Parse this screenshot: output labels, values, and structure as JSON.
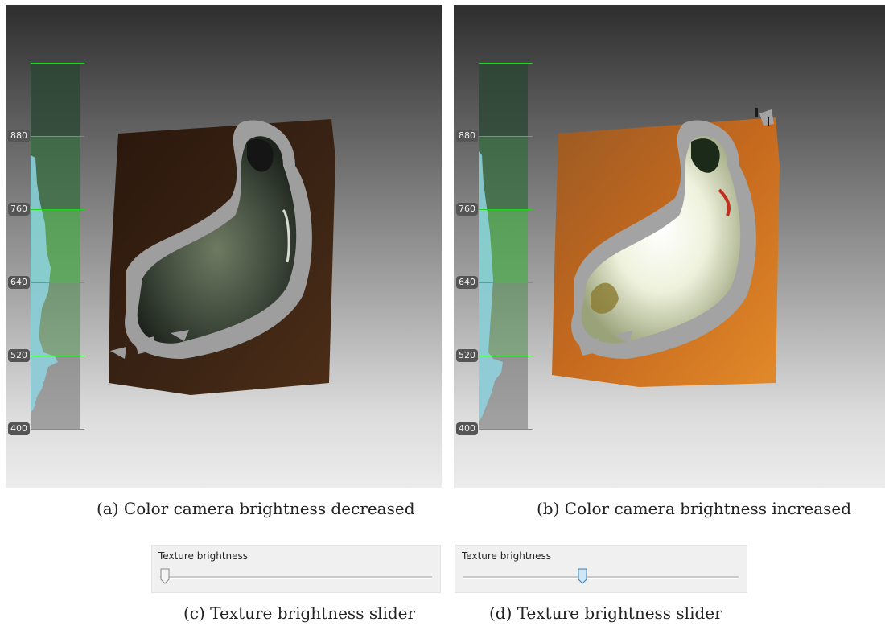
{
  "panels": {
    "a": {
      "gauge_ticks": [
        "880",
        "760",
        "640",
        "520",
        "400"
      ],
      "caption": "(a) Color camera brightness decreased"
    },
    "b": {
      "gauge_ticks": [
        "880",
        "760",
        "640",
        "520",
        "400"
      ],
      "caption": "(b) Color camera brightness increased"
    }
  },
  "sliders": {
    "c": {
      "title": "Texture brightness",
      "value_fraction": 0.0,
      "caption": "(c) Texture brightness slider"
    },
    "d": {
      "title": "Texture brightness",
      "value_fraction": 0.43,
      "caption": "(d) Texture brightness slider"
    }
  },
  "colors": {
    "gauge_line": "#22d422",
    "histogram": "#8fd3e0",
    "wood_dark": "#3a2212",
    "wood_bright": "#d8741e"
  },
  "icons": [
    "bird-figurine",
    "wooden-board"
  ]
}
